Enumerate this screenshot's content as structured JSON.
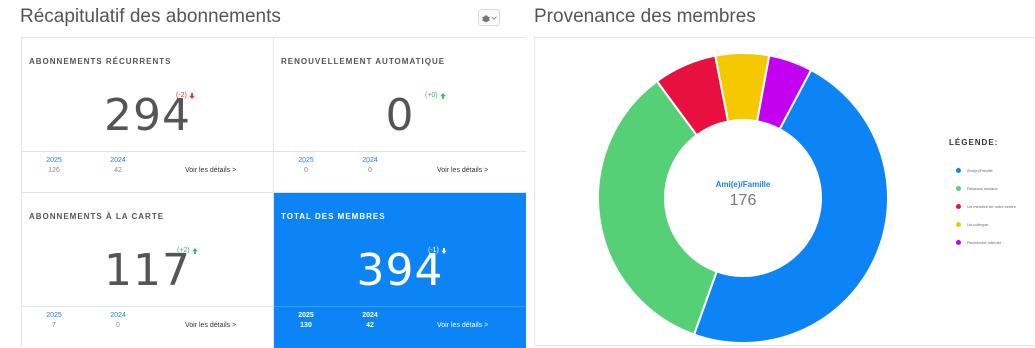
{
  "summary": {
    "title": "Récapitulatif des abonnements",
    "cards": [
      {
        "title": "ABONNEMENTS RÉCURRENTS",
        "value": "294",
        "delta": "(-2)",
        "delta_direction": "down",
        "years": [
          {
            "year": "2025",
            "value": "126"
          },
          {
            "year": "2024",
            "value": "42"
          }
        ],
        "details": "Voir les détails >"
      },
      {
        "title": "RENOUVELLEMENT AUTOMATIQUE",
        "value": "0",
        "delta": "(+0)",
        "delta_direction": "up",
        "years": [
          {
            "year": "2025",
            "value": "0"
          },
          {
            "year": "2024",
            "value": "0"
          }
        ],
        "details": "Voir les détails >"
      },
      {
        "title": "ABONNEMENTS À LA CARTE",
        "value": "117",
        "delta": "(+2)",
        "delta_direction": "up",
        "years": [
          {
            "year": "2025",
            "value": "7"
          },
          {
            "year": "2024",
            "value": "0"
          }
        ],
        "details": "Voir les détails >"
      },
      {
        "title": "TOTAL DES MEMBRES",
        "value": "394",
        "delta": "(-1)",
        "delta_direction": "down",
        "years": [
          {
            "year": "2025",
            "value": "130"
          },
          {
            "year": "2024",
            "value": "42"
          }
        ],
        "details": "Voir les détails >"
      }
    ]
  },
  "settings": {
    "icon": "gear-icon",
    "chevron": "chevron-down-icon"
  },
  "members": {
    "title": "Provenance des membres",
    "center_label": "Ami(e)/Famille",
    "center_value": "176",
    "legend_title": "LÉGENDE:",
    "segments": [
      {
        "label": "Ami(e)/Famille",
        "value": 176,
        "color": "#0c84f5"
      },
      {
        "label": "Réseaux sociaux",
        "value": 127,
        "color": "#55d077"
      },
      {
        "label": "Un membre de notre centre",
        "value": 26,
        "color": "#e8103f"
      },
      {
        "label": "Un collègue",
        "value": 22,
        "color": "#f5c800"
      },
      {
        "label": "Recherche Internet",
        "value": 18,
        "color": "#c400f0"
      }
    ]
  },
  "colors": {
    "accent": "#0c84f5",
    "down": "#d9312b",
    "up": "#35b56a"
  }
}
